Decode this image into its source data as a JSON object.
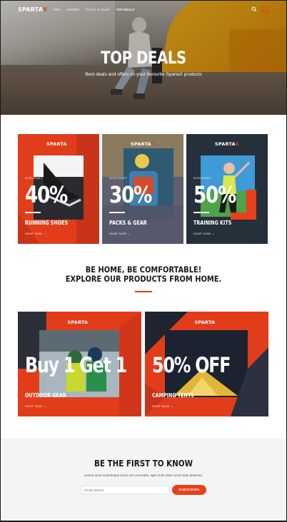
{
  "nav": {
    "logo_main": "SPARTA",
    "logo_x": "X",
    "links": [
      "MEN",
      "WOMEN",
      "PACKS & GEAR",
      "TOP DEALS"
    ],
    "cart_count": "0",
    "search_icon": "search-icon",
    "cart_icon": "cart-icon"
  },
  "hero": {
    "title": "TOP DEALS",
    "subtitle": "Best deals and offers on your favourite SpartaX products"
  },
  "deals": [
    {
      "logo_main": "SPARTA",
      "logo_x": "X",
      "label": "DISCOUNT",
      "percent": "40%",
      "category": "RUNNING SHOES",
      "link": "SHOP NOW  →",
      "accent": "#e8401c"
    },
    {
      "logo_main": "SPARTA",
      "logo_x": "X",
      "label": "DISCOUNT",
      "percent": "30%",
      "category": "PACKS & GEAR",
      "link": "SHOP NOW  →",
      "accent": "#4a4a58"
    },
    {
      "logo_main": "SPARTA",
      "logo_x": "X",
      "label": "DISCOUNT",
      "percent": "50%",
      "category": "TRAINING KITS",
      "link": "SHOP NOW  →",
      "accent": "#e8401c"
    }
  ],
  "middle": {
    "line1": "BE HOME, BE COMFORTABLE!",
    "line2": "EXPLORE OUR PRODUCTS FROM HOME."
  },
  "promos": [
    {
      "logo_main": "SPARTA",
      "logo_x": "X",
      "headline": "Buy 1 Get 1",
      "category": "OUTDOOR GEAR",
      "link": "SHOP NOW  →"
    },
    {
      "logo_main": "SPARTA",
      "logo_x": "X",
      "headline": "50% OFF",
      "category": "CAMPING TENTS",
      "link": "SHOP NOW  →"
    }
  ],
  "newsletter": {
    "title": "BE THE FIRST TO KNOW",
    "text": "Lectus amet scelerisque fusce est venenatis, eget enim dolor amet vitae pharetra.",
    "email_placeholder": "Email address",
    "button": "SUBSCRIBE"
  },
  "colors": {
    "accent": "#e8401c",
    "dark": "#1a1a1a",
    "newsletter_bg": "#f3f4f6"
  }
}
